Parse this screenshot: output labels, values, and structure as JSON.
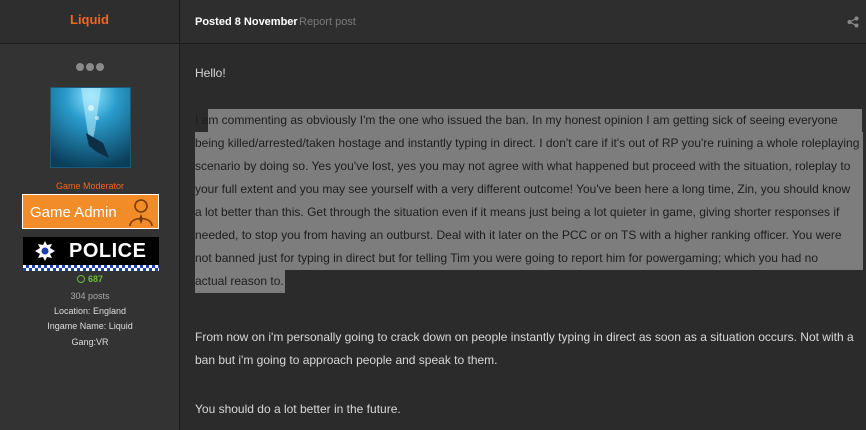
{
  "author": {
    "username": "Liquid",
    "group_title": "Game Moderator",
    "badge_admin_label": "Game Admin",
    "badge_police_label": "POLICE",
    "reputation": "687",
    "posts": "304 posts",
    "location": "Location: England",
    "ingame_name": "Ingame Name: Liquid",
    "gang": "Gang:VR"
  },
  "post": {
    "posted_label": "Posted 8 November",
    "separator": "·",
    "report_label": "Report post",
    "paragraph_1": "Hello!",
    "paragraph_2_lines": [
      "I am commenting as obviously I'm the one who issued the ban. In my honest opinion I am getting sick of seeing everyone",
      "being killed/arrested/taken hostage and instantly typing in direct. I don't care if it's out of RP you're ruining a whole roleplaying",
      "scenario by doing so. Yes you've lost, yes you may not agree with what happened but proceed with the situation, roleplay to",
      "your full extent and you may see yourself with a very different outcome! You've been here a long time, Zin, you should know",
      "a lot better than this. Get through the situation even if it means just being a lot quieter in game, giving shorter responses if",
      "needed, to stop you from having an outburst. Deal with it later on the PCC or on TS with a higher ranking officer. You were",
      "not banned just for typing in direct but for telling Tim you were going to report him for powergaming; which you had no",
      "actual reason to."
    ],
    "paragraph_3": "From now on i'm personally going to crack down on people instantly typing in direct as soon as a situation occurs. Not with a ban but i'm going to approach people and speak to them.",
    "paragraph_4": "You should do a lot better in the future."
  },
  "colors": {
    "accent": "#f26522",
    "admin_badge": "#f28c28",
    "reputation": "#6dbb3c",
    "selection_highlight": "#7d7d7d"
  },
  "icons": [
    "more-options-icon",
    "avatar-image",
    "admin-badge-icon",
    "police-crest-icon",
    "reputation-icon",
    "share-icon"
  ]
}
